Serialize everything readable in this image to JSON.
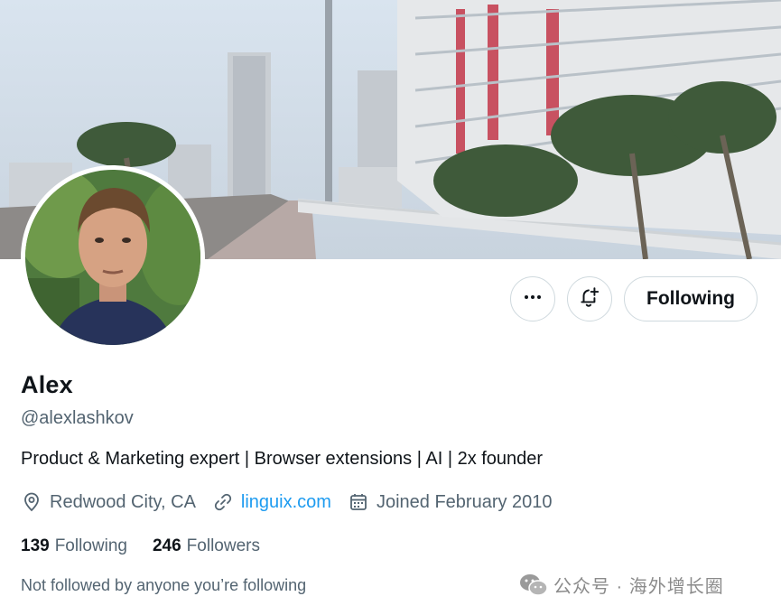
{
  "profile": {
    "name": "Alex",
    "handle": "@alexlashkov",
    "bio": "Product & Marketing expert | Browser extensions | AI | 2x founder",
    "location": "Redwood City, CA",
    "website": "linguix.com",
    "joined": "Joined February 2010",
    "following_count": "139",
    "following_label": "Following",
    "followers_count": "246",
    "followers_label": "Followers",
    "not_followed_note": "Not followed by anyone you’re following"
  },
  "actions": {
    "more_label": "•••",
    "follow_button_label": "Following"
  },
  "icons": {
    "more": "more-horizontal-icon",
    "bell": "notification-bell-plus-icon",
    "location": "location-pin-icon",
    "link": "link-icon",
    "calendar": "calendar-icon",
    "watermark": "wechat-icon"
  },
  "watermark": {
    "text": "公众号 · 海外增长圈"
  },
  "colors": {
    "text_primary": "#0f1419",
    "text_secondary": "#536471",
    "link": "#1d9bf0",
    "border": "#cfd9de"
  }
}
